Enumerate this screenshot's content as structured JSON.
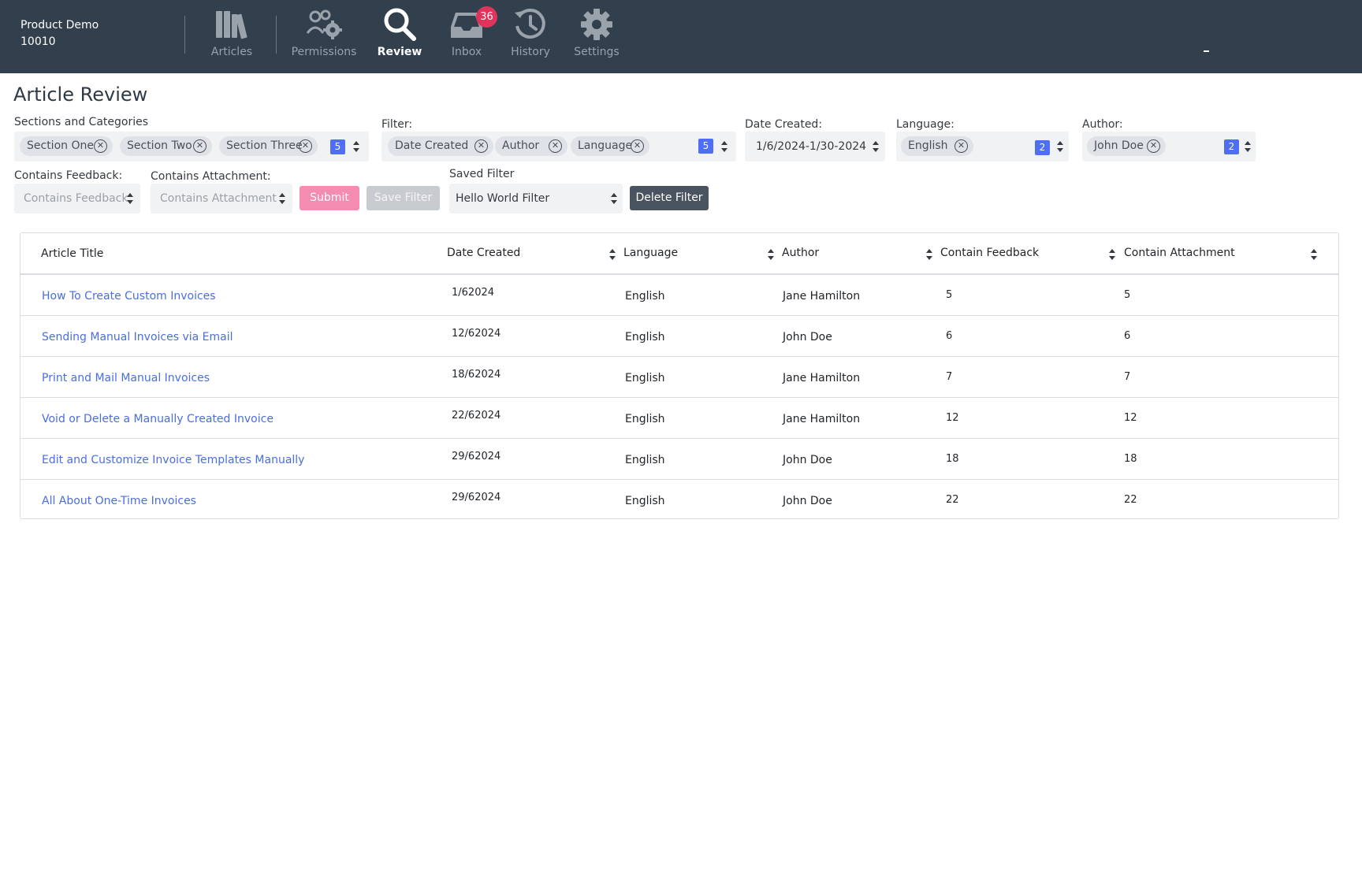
{
  "brand": {
    "name": "Product Demo",
    "id": "10010"
  },
  "nav": {
    "items": [
      {
        "label": "Articles",
        "icon": "books-icon"
      },
      {
        "label": "Permissions",
        "icon": "users-gear-icon"
      },
      {
        "label": "Review",
        "icon": "search-icon",
        "active": true
      },
      {
        "label": "Inbox",
        "icon": "inbox-icon",
        "badge": "36"
      },
      {
        "label": "History",
        "icon": "history-icon"
      },
      {
        "label": "Settings",
        "icon": "gear-icon"
      }
    ]
  },
  "page": {
    "title": "Article Review"
  },
  "filters": {
    "sections": {
      "label": "Sections and Categories",
      "chips": [
        "Section One",
        "Section Two",
        "Section Three"
      ],
      "count": "5"
    },
    "filter": {
      "label": "Filter:",
      "chips": [
        "Date Created",
        "Author",
        "Language"
      ],
      "count": "5"
    },
    "date_created": {
      "label": "Date Created:",
      "value": "1/6/2024-1/30-2024"
    },
    "language": {
      "label": "Language:",
      "chips": [
        "English"
      ],
      "count": "2"
    },
    "author": {
      "label": "Author:",
      "chips": [
        "John Doe"
      ],
      "count": "2"
    },
    "contains_feedback": {
      "label": "Contains Feedback:",
      "placeholder": "Contains Feedback"
    },
    "contains_attachment": {
      "label": "Contains Attachment:",
      "placeholder": "Contains Attachment"
    },
    "saved_filter": {
      "label": "Saved Filter",
      "value": "Hello World Filter"
    },
    "buttons": {
      "submit": "Submit",
      "save": "Save Filter",
      "delete": "Delete Filter"
    }
  },
  "table": {
    "columns": [
      "Article Title",
      "Date Created",
      "Language",
      "Author",
      "Contain Feedback",
      "Contain Attachment"
    ],
    "rows": [
      {
        "title": "How To Create Custom Invoices",
        "date": "1/62024",
        "language": "English",
        "author": "Jane Hamilton",
        "feedback": "5",
        "attachment": "5"
      },
      {
        "title": "Sending Manual Invoices via Email",
        "date": "12/62024",
        "language": "English",
        "author": "John Doe",
        "feedback": "6",
        "attachment": "6"
      },
      {
        "title": "Print and Mail Manual Invoices",
        "date": "18/62024",
        "language": "English",
        "author": "Jane Hamilton",
        "feedback": "7",
        "attachment": "7"
      },
      {
        "title": "Void or Delete a Manually Created Invoice",
        "date": "22/62024",
        "language": "English",
        "author": "Jane Hamilton",
        "feedback": "12",
        "attachment": "12"
      },
      {
        "title": "Edit and Customize Invoice Templates Manually",
        "date": "29/62024",
        "language": "English",
        "author": "John Doe",
        "feedback": "18",
        "attachment": "18"
      },
      {
        "title": "All About One-Time Invoices",
        "date": "29/62024",
        "language": "English",
        "author": "John Doe",
        "feedback": "22",
        "attachment": "22"
      }
    ]
  },
  "colors": {
    "topbar": "#323f4d",
    "link": "#4a6ee0",
    "badge": "#e0345d",
    "count": "#4f6ef7",
    "submit": "#f48bb1"
  }
}
